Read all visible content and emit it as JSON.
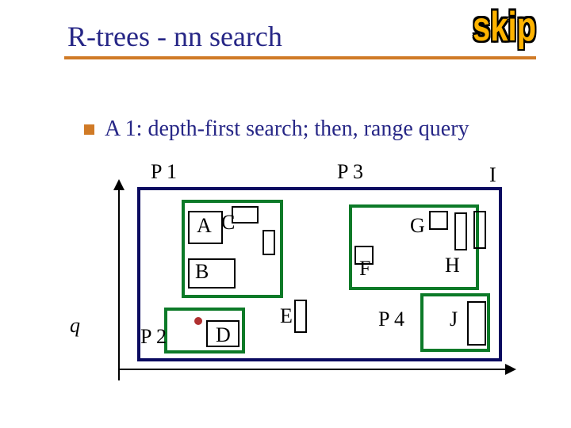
{
  "title": "R-trees - nn search",
  "badge": "skip",
  "bullet_text": "A 1: depth-first search; then, range query",
  "labels": {
    "P1": "P 1",
    "P2": "P 2",
    "P3": "P 3",
    "P4": "P 4",
    "A": "A",
    "B": "B",
    "C": "C",
    "D": "D",
    "E": "E",
    "F": "F",
    "G": "G",
    "H": "H",
    "I": "I",
    "J": "J",
    "q": "q"
  }
}
